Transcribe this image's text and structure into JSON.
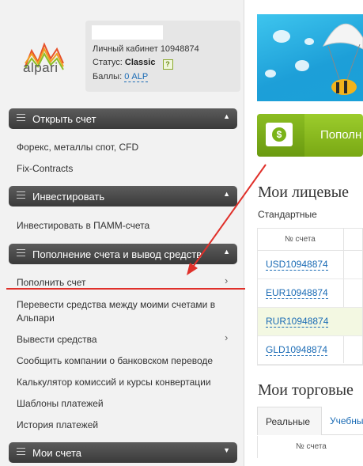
{
  "brand": {
    "logo_text": "alpari"
  },
  "profile": {
    "account_label": "Личный кабинет 10948874",
    "status_label": "Статус:",
    "status_value": "Classic",
    "help_glyph": "?",
    "points_label": "Баллы:",
    "points_value": "0 ALP"
  },
  "sidebar": {
    "open_account": {
      "title": "Открыть счет",
      "arrow": "▲"
    },
    "open_items": [
      "Форекс, металлы спот, CFD",
      "Fix-Contracts"
    ],
    "invest": {
      "title": "Инвестировать",
      "arrow": "▲"
    },
    "invest_items": [
      "Инвестировать в ПАММ-счета"
    ],
    "funding": {
      "title": "Пополнение счета и вывод средств",
      "arrow": "▲"
    },
    "funding_items": [
      "Пополнить счет",
      "Перевести средства между моими счетами в",
      "Альпари",
      "Вывести средства",
      "Сообщить компании о банковском переводе",
      "Калькулятор комиссий и курсы конвертации",
      "Шаблоны платежей",
      "История платежей"
    ],
    "chevron": "›",
    "my_accounts": {
      "title": "Мои счета",
      "arrow": "▼"
    }
  },
  "main": {
    "deposit_button_label": "Пополн",
    "dollar_glyph": "$",
    "personal_accounts_title": "Мои лицевые",
    "standard_label": "Стандартные",
    "table_header": "№ счета",
    "accounts": [
      "USD10948874",
      "EUR10948874",
      "RUR10948874",
      "GLD10948874"
    ],
    "trading_accounts_title": "Мои торговые",
    "tabs": [
      "Реальные",
      "Учебны"
    ],
    "table2_header": "№ счета"
  },
  "colors": {
    "accent_green": "#8bbd22",
    "link_blue": "#1a6bb5",
    "annotation_red": "#e0302a",
    "header_dark": "#4a4a4a"
  }
}
